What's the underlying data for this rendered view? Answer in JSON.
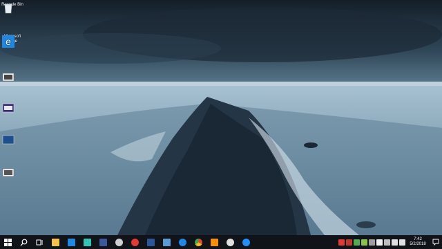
{
  "desktop": {
    "icons": [
      {
        "label": "Recycle Bin",
        "icon": "recycle-bin-icon"
      },
      {
        "label": "Microsoft Edge",
        "icon": "edge-icon"
      },
      {
        "label": "",
        "icon": "shortcut-icon"
      },
      {
        "label": "",
        "icon": "shortcut-icon"
      },
      {
        "label": "",
        "icon": "shortcut-icon"
      },
      {
        "label": "",
        "icon": "shortcut-icon"
      }
    ]
  },
  "taskbar": {
    "start": "windows-start-icon",
    "search": "search-icon",
    "task_view": "task-view-icon",
    "pinned": [
      {
        "name": "file-explorer-icon",
        "color": "#f3c344"
      },
      {
        "name": "store-icon",
        "color": "#1e88e5"
      },
      {
        "name": "app-icon",
        "color": "#2ec4b6"
      },
      {
        "name": "facebook-icon",
        "color": "#3b5998"
      },
      {
        "name": "settings-app-icon",
        "color": "#cfcfcf"
      },
      {
        "name": "opera-icon",
        "color": "#e53935"
      },
      {
        "name": "word-icon",
        "color": "#2b579a"
      },
      {
        "name": "photos-icon",
        "color": "#5b9bd5"
      },
      {
        "name": "edge-icon",
        "color": "#1e88e5"
      },
      {
        "name": "chrome-icon",
        "color": "#fbbc05"
      },
      {
        "name": "media-icon",
        "color": "#ff8f00"
      },
      {
        "name": "gear-icon",
        "color": "#e0e0e0"
      },
      {
        "name": "edge-icon",
        "color": "#1e90ff"
      }
    ],
    "clock": {
      "time": "7:42",
      "date": "5/2/2018"
    }
  }
}
